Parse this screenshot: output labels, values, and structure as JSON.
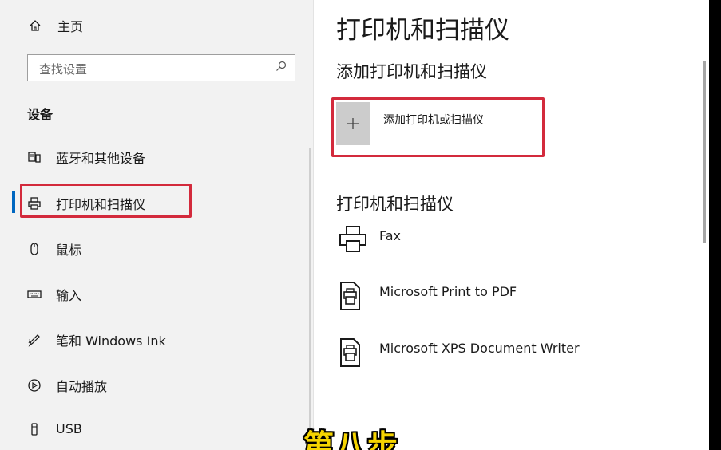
{
  "sidebar": {
    "home_label": "主页",
    "search_placeholder": "查找设置",
    "section_title": "设备",
    "items": [
      {
        "label": "蓝牙和其他设备",
        "icon": "bluetooth-devices-icon"
      },
      {
        "label": "打印机和扫描仪",
        "icon": "printer-icon",
        "selected": true
      },
      {
        "label": "鼠标",
        "icon": "mouse-icon"
      },
      {
        "label": "输入",
        "icon": "keyboard-icon"
      },
      {
        "label": "笔和 Windows Ink",
        "icon": "pen-icon"
      },
      {
        "label": "自动播放",
        "icon": "autoplay-icon"
      },
      {
        "label": "USB",
        "icon": "usb-icon"
      }
    ]
  },
  "main": {
    "title": "打印机和扫描仪",
    "add_section_title": "添加打印机和扫描仪",
    "add_button_label": "添加打印机或扫描仪",
    "list_section_title": "打印机和扫描仪",
    "devices": [
      {
        "name": "Fax",
        "icon": "fax-printer-icon"
      },
      {
        "name": "Microsoft Print to PDF",
        "icon": "document-printer-icon"
      },
      {
        "name": "Microsoft XPS Document Writer",
        "icon": "document-printer-icon"
      }
    ]
  },
  "overlay": {
    "caption": "第八步",
    "caption_color": "#f5d400"
  },
  "colors": {
    "highlight_border": "#d32a3c",
    "accent": "#0067c0"
  }
}
